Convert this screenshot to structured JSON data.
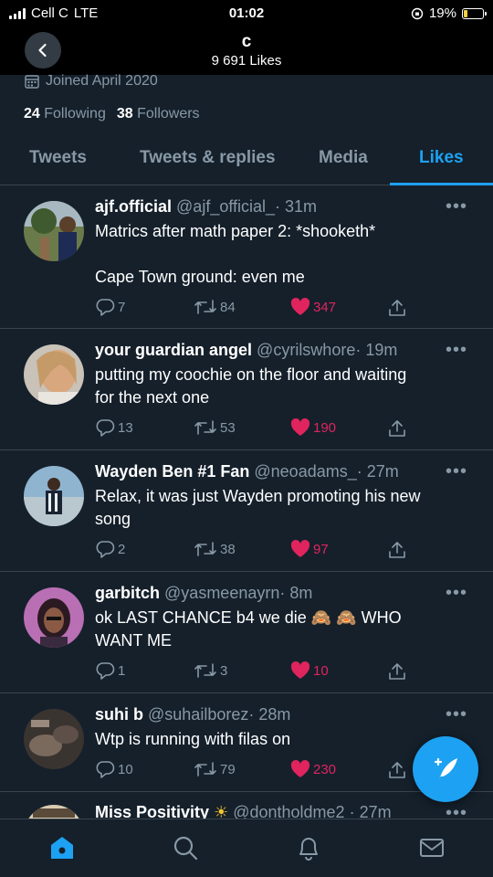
{
  "status_bar": {
    "carrier": "Cell C",
    "network": "LTE",
    "time": "01:02",
    "battery": "19%",
    "battery_level": 0.19
  },
  "header": {
    "name": "c",
    "likes_count": "9 691 Likes"
  },
  "profile": {
    "joined": "Joined April 2020",
    "following_count": "24",
    "following_label": "Following",
    "followers_count": "38",
    "followers_label": "Followers"
  },
  "tabs": [
    {
      "label": "Tweets",
      "active": false
    },
    {
      "label": "Tweets & replies",
      "active": false
    },
    {
      "label": "Media",
      "active": false
    },
    {
      "label": "Likes",
      "active": true
    }
  ],
  "tweets": [
    {
      "name": "ajf.official",
      "handle": "@ajf_official_",
      "time": "· 31m",
      "body_line1": "Matrics after math paper 2: *shooketh*",
      "body_line2": "",
      "body_line3": "Cape Town ground: even me",
      "replies": "7",
      "retweets": "84",
      "likes": "347"
    },
    {
      "name": "your guardian angel",
      "handle": "@cyrilswhore",
      "time": "· 19m",
      "body_line1": "putting my coochie on the floor and waiting",
      "body_line2": "for the next one",
      "replies": "13",
      "retweets": "53",
      "likes": "190"
    },
    {
      "name": "Wayden Ben #1 Fan",
      "handle": "@neoadams_",
      "time": "· 27m",
      "body_line1": "Relax, it was just Wayden promoting his new",
      "body_line2": "song",
      "replies": "2",
      "retweets": "38",
      "likes": "97"
    },
    {
      "name": "garbitch",
      "handle": "@yasmeenayrn",
      "time": "· 8m",
      "body_line1a": "ok LAST CHANCE b4 we die",
      "body_emoji": "🙈 🙈",
      "body_line1b": "WHO",
      "body_line2": "WANT ME",
      "replies": "1",
      "retweets": "3",
      "likes": "10"
    },
    {
      "name": "suhi b",
      "handle": "@suhailborez",
      "time": "· 28m",
      "body_line1": "Wtp is running with filas on",
      "replies": "10",
      "retweets": "79",
      "likes": "230"
    },
    {
      "name": "Miss Positivity",
      "handle": "@dontholdme2",
      "time": "· 27m",
      "emoji": "☀"
    }
  ],
  "more_label": "•••",
  "colors": {
    "background": "#15202b",
    "accent": "#1da1f2",
    "like": "#e0245e",
    "muted": "#8899a6",
    "divider": "#38444d"
  },
  "icons": [
    "back-arrow-icon",
    "calendar-icon",
    "reply-icon",
    "retweet-icon",
    "heart-icon",
    "share-icon",
    "compose-icon",
    "home-icon",
    "search-icon",
    "bell-icon",
    "mail-icon"
  ]
}
